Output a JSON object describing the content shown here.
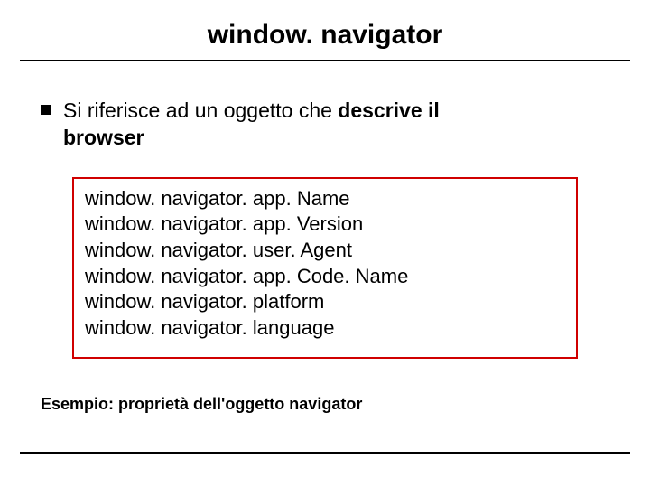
{
  "title": "window. navigator",
  "bullet": {
    "pre": "Si riferisce ad un oggetto che ",
    "bold1": "descrive il",
    "bold2": "browser"
  },
  "code": {
    "l0": "window. navigator. app. Name",
    "l1": "window. navigator. app. Version",
    "l2": "window. navigator. user. Agent",
    "l3": "window. navigator. app. Code. Name",
    "l4": "window. navigator. platform",
    "l5": "window. navigator. language"
  },
  "example": "Esempio: proprietà dell'oggetto navigator"
}
